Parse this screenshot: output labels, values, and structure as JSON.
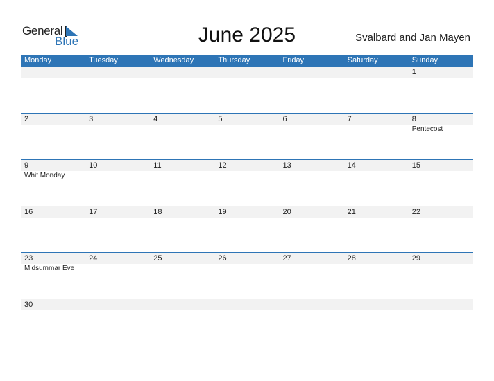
{
  "logo": {
    "general": "General",
    "blue": "Blue"
  },
  "title": "June 2025",
  "region": "Svalbard and Jan Mayen",
  "colors": {
    "accent": "#2e75b6",
    "strip": "#f2f2f2"
  },
  "weekdays": [
    "Monday",
    "Tuesday",
    "Wednesday",
    "Thursday",
    "Friday",
    "Saturday",
    "Sunday"
  ],
  "weeks": [
    {
      "days": [
        "",
        "",
        "",
        "",
        "",
        "",
        "1"
      ],
      "events": [
        "",
        "",
        "",
        "",
        "",
        "",
        ""
      ]
    },
    {
      "days": [
        "2",
        "3",
        "4",
        "5",
        "6",
        "7",
        "8"
      ],
      "events": [
        "",
        "",
        "",
        "",
        "",
        "",
        "Pentecost"
      ]
    },
    {
      "days": [
        "9",
        "10",
        "11",
        "12",
        "13",
        "14",
        "15"
      ],
      "events": [
        "Whit Monday",
        "",
        "",
        "",
        "",
        "",
        ""
      ]
    },
    {
      "days": [
        "16",
        "17",
        "18",
        "19",
        "20",
        "21",
        "22"
      ],
      "events": [
        "",
        "",
        "",
        "",
        "",
        "",
        ""
      ]
    },
    {
      "days": [
        "23",
        "24",
        "25",
        "26",
        "27",
        "28",
        "29"
      ],
      "events": [
        "Midsummar Eve",
        "",
        "",
        "",
        "",
        "",
        ""
      ]
    },
    {
      "days": [
        "30",
        "",
        "",
        "",
        "",
        "",
        ""
      ],
      "events": [
        "",
        "",
        "",
        "",
        "",
        "",
        ""
      ]
    }
  ]
}
